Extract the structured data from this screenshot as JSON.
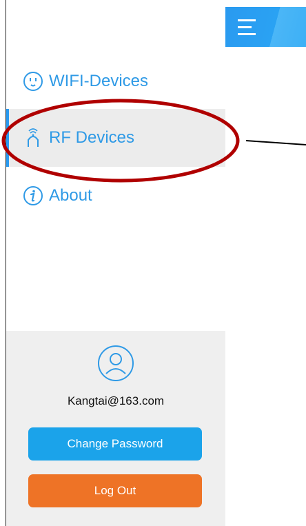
{
  "nav": {
    "items": [
      {
        "label": "WIFI-Devices",
        "icon": "outlet-icon"
      },
      {
        "label": "RF Devices",
        "icon": "rf-signal-icon",
        "active": true
      },
      {
        "label": "About",
        "icon": "info-icon"
      }
    ]
  },
  "account": {
    "email": "Kangtai@163.com",
    "change_password_label": "Change Password",
    "logout_label": "Log Out"
  },
  "colors": {
    "accent": "#2a9af0",
    "logout": "#ee7326",
    "annotation": "#b00000"
  }
}
